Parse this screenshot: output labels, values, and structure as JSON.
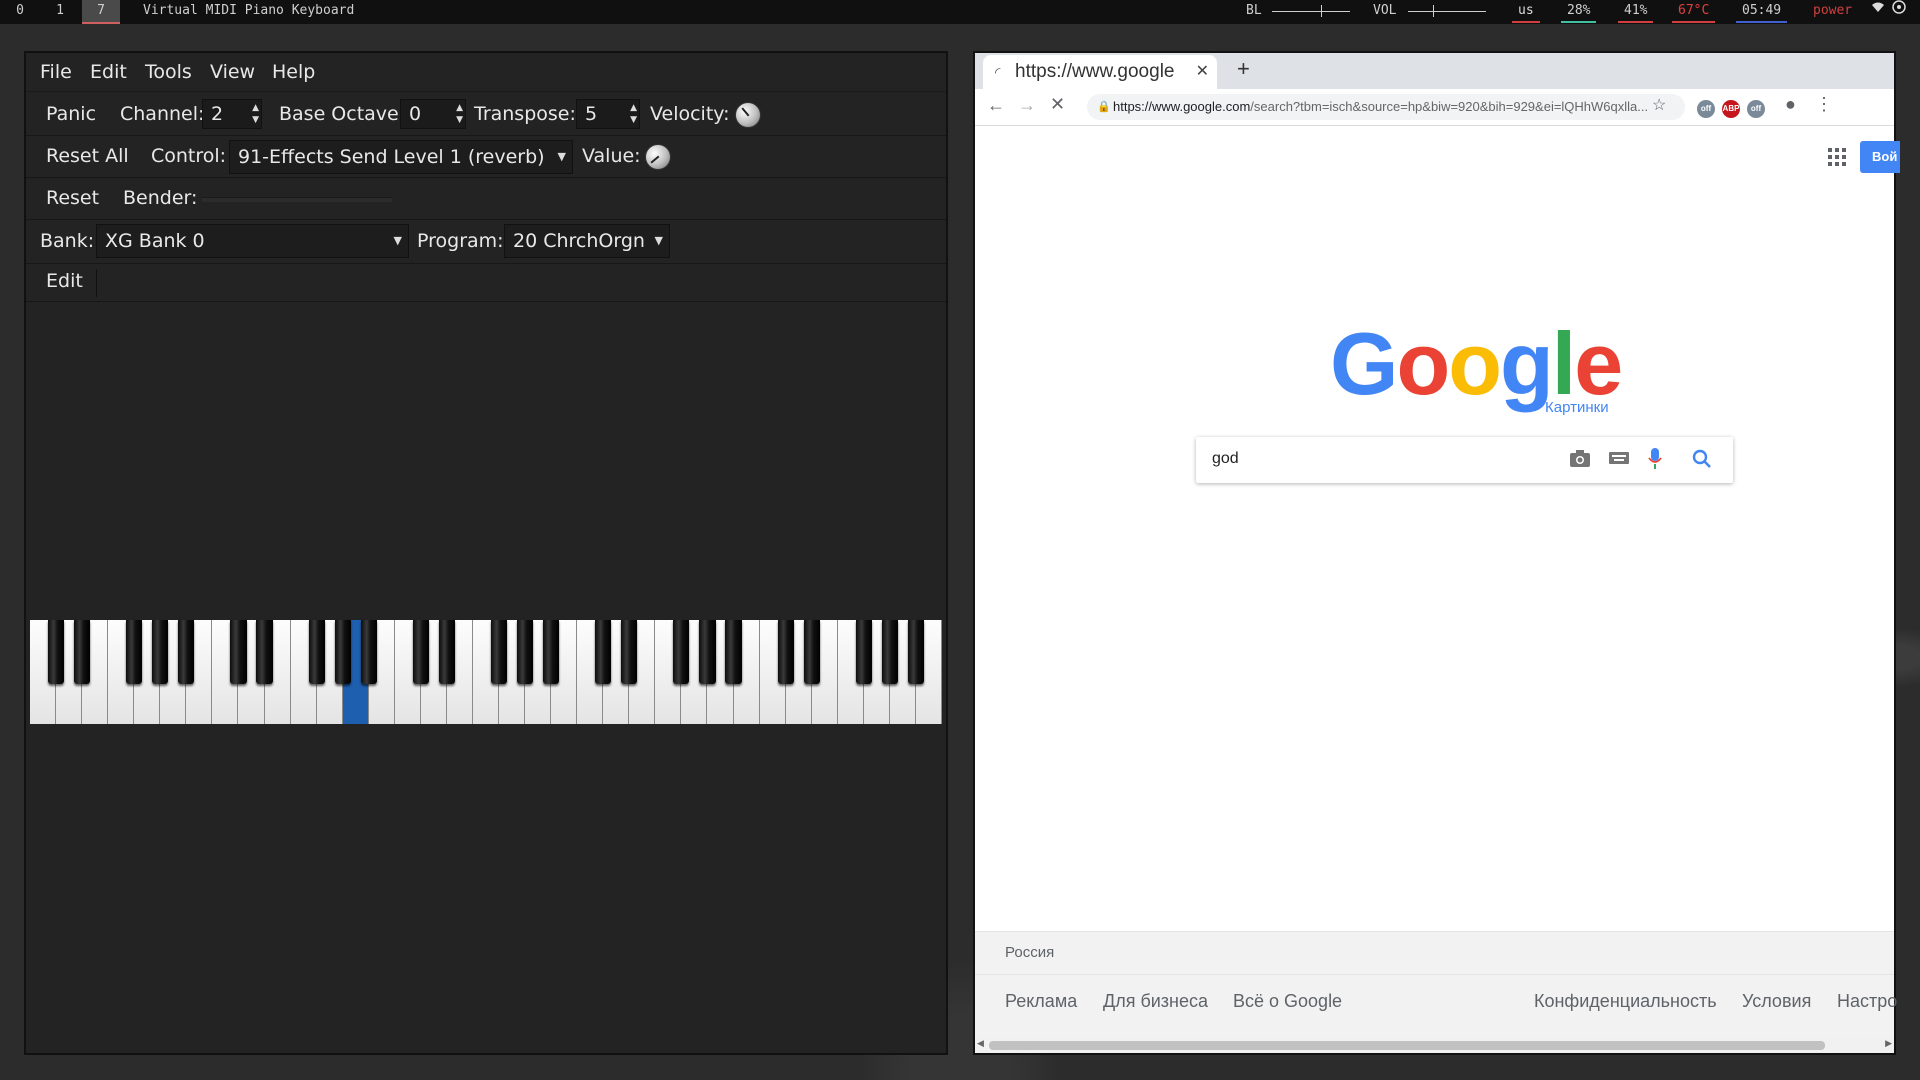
{
  "topbar": {
    "workspaces": [
      "0",
      "1",
      "7"
    ],
    "window_title": "Virtual MIDI Piano Keyboard",
    "bl_label": "BL",
    "vol_label": "VOL",
    "kbd_layout": "us",
    "stat1": "28%",
    "stat2": "41%",
    "temp": "67°C",
    "clock": "05:49",
    "power": "power"
  },
  "vmpk": {
    "menu": [
      "File",
      "Edit",
      "Tools",
      "View",
      "Help"
    ],
    "panic": "Panic",
    "channel_label": "Channel:",
    "channel_value": "2",
    "base_octave_label": "Base Octave:",
    "base_octave_value": "0",
    "transpose_label": "Transpose:",
    "transpose_value": "5",
    "velocity_label": "Velocity:",
    "reset_all": "Reset All",
    "control_label": "Control:",
    "control_value": "91-Effects Send Level 1 (reverb)",
    "value_label": "Value:",
    "reset": "Reset",
    "bender_label": "Bender:",
    "bank_label": "Bank:",
    "bank_value": "XG Bank 0",
    "program_label": "Program:",
    "program_value": "20 ChrchOrgn",
    "edit": "Edit",
    "keyboard": {
      "white_keys": 35,
      "pressed_white_key_index": 12
    }
  },
  "chrome": {
    "tab_title": "https://www.google",
    "new_tab": "+",
    "url_domain": "https://www.google.com",
    "url_path": "/search?tbm=isch&source=hp&biw=920&bih=929&ei=lQHhW6qxlla...",
    "signin": "Вой",
    "logo_sub": "Картинки",
    "search_value": "god",
    "region": "Россия",
    "footer_links_left": [
      "Реклама",
      "Для бизнеса",
      "Всё о Google"
    ],
    "footer_links_right": [
      "Конфиденциальность",
      "Условия",
      "Настро"
    ],
    "colors": {
      "blue": "#4285f4",
      "red": "#ea4335",
      "yellow": "#fbbc05",
      "green": "#34a853"
    }
  }
}
